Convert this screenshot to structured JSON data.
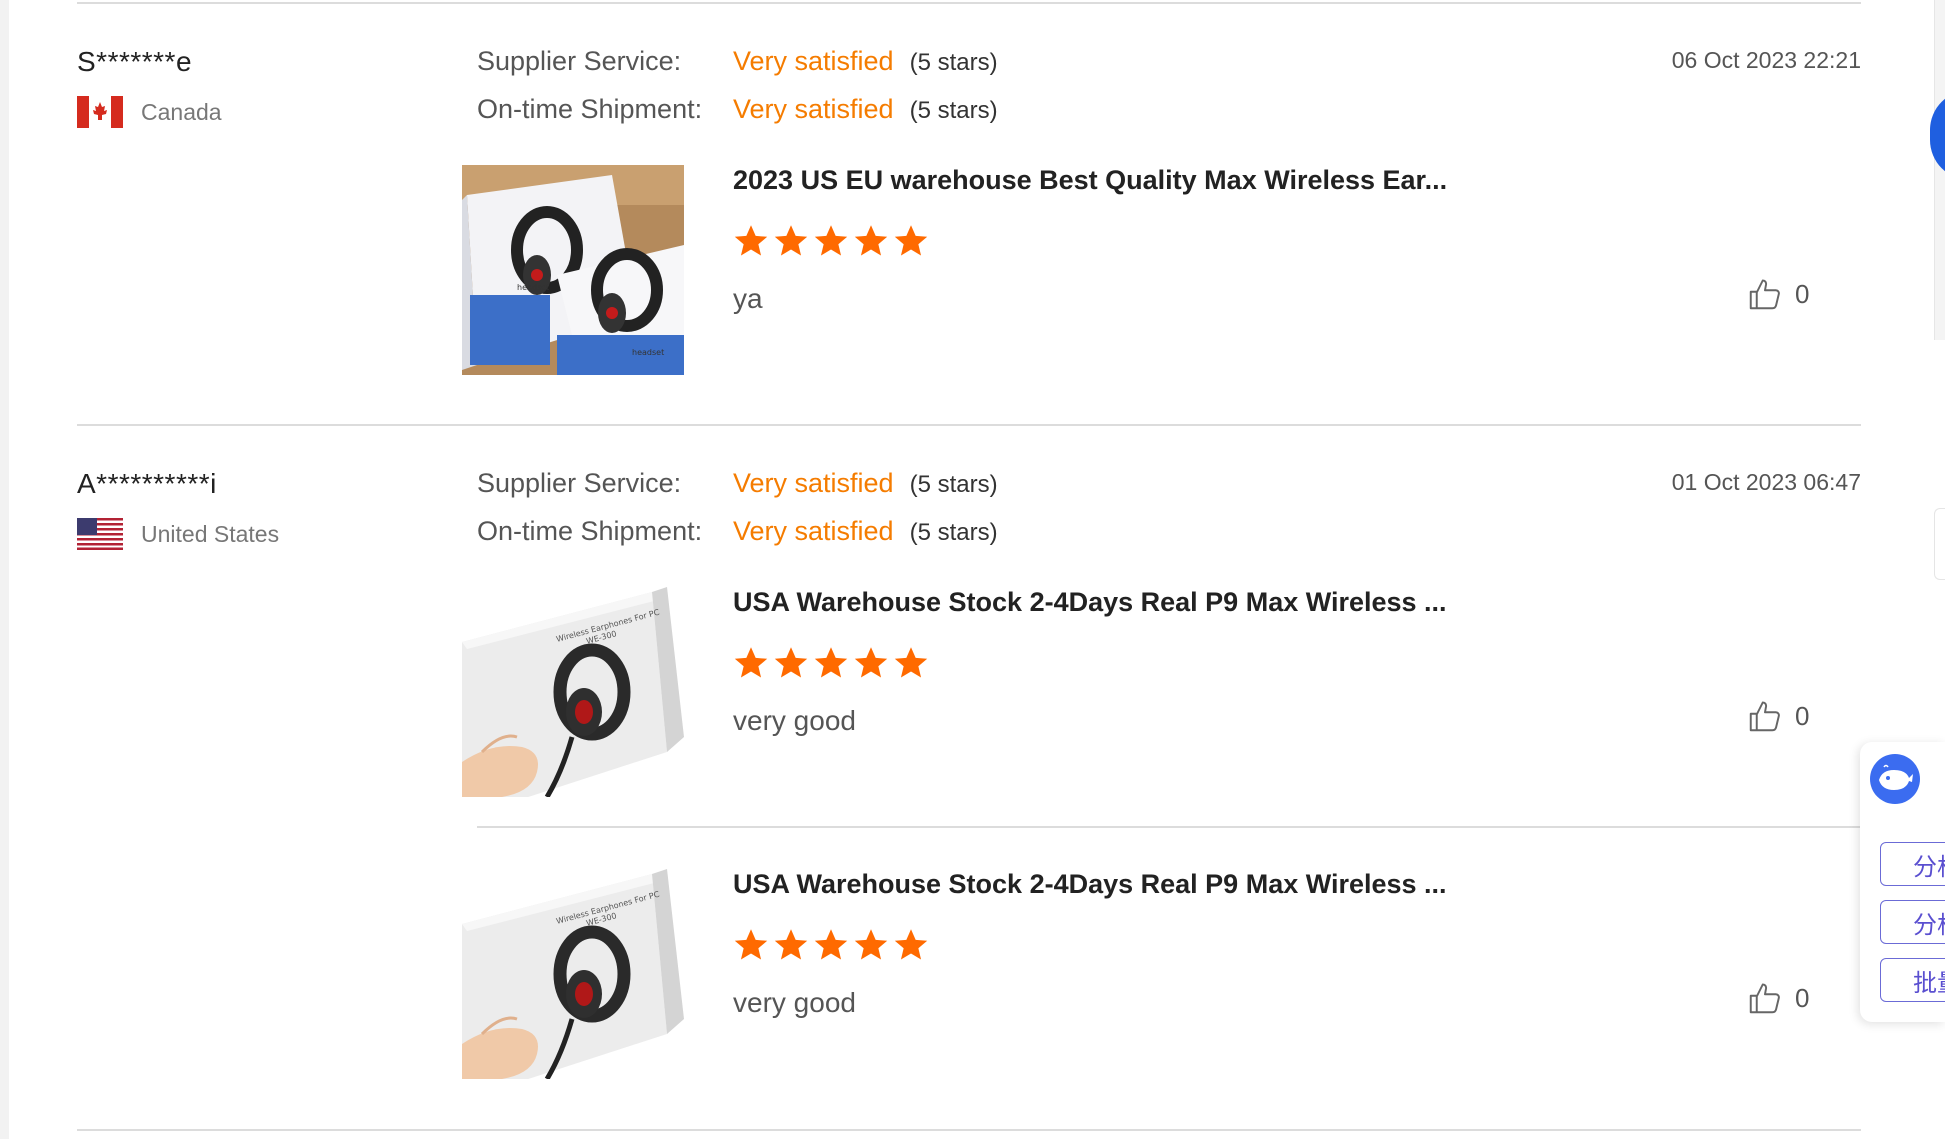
{
  "labels": {
    "supplier_service": "Supplier Service:",
    "ontime_shipment": "On-time Shipment:"
  },
  "reviews": [
    {
      "user": "S*******e",
      "country": "Canada",
      "flag_icon": "canada-flag-icon",
      "date": "06 Oct 2023 22:21",
      "supplier_service": "Very satisfied",
      "supplier_service_stars": "(5 stars)",
      "ontime_shipment": "Very satisfied",
      "ontime_shipment_stars": "(5 stars)",
      "products": [
        {
          "title": "2023 US EU warehouse Best Quality Max Wireless Ear...",
          "rating": 5,
          "comment": "ya",
          "likes": "0"
        }
      ]
    },
    {
      "user": "A**********i",
      "country": "United States",
      "flag_icon": "us-flag-icon",
      "date": "01 Oct 2023 06:47",
      "supplier_service": "Very satisfied",
      "supplier_service_stars": "(5 stars)",
      "ontime_shipment": "Very satisfied",
      "ontime_shipment_stars": "(5 stars)",
      "products": [
        {
          "title": "USA Warehouse Stock 2-4Days Real P9 Max Wireless ...",
          "rating": 5,
          "comment": "very good",
          "likes": "0"
        },
        {
          "title": "USA Warehouse Stock 2-4Days Real P9 Max Wireless ...",
          "rating": 5,
          "comment": "very good",
          "likes": "0"
        }
      ]
    }
  ],
  "side_panel": {
    "icon": "whale-icon",
    "buttons": [
      "分析",
      "分析",
      "批量"
    ]
  },
  "colors": {
    "accent": "#f57c00",
    "star": "#ff6a00",
    "panel_button": "#5a4fd0"
  }
}
